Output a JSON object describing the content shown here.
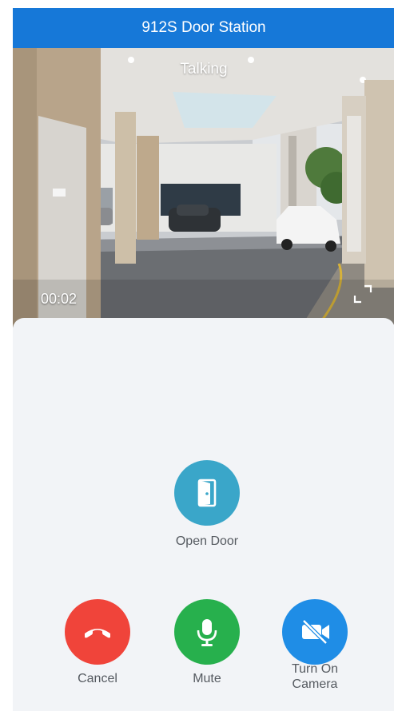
{
  "header": {
    "title": "912S Door Station"
  },
  "video": {
    "status": "Talking",
    "timer": "00:02"
  },
  "actions": {
    "open_door": {
      "label": "Open Door",
      "icon": "door-icon",
      "color": "#3aa6c9"
    },
    "cancel": {
      "label": "Cancel",
      "icon": "hang-up-icon",
      "color": "#f0443a"
    },
    "mute": {
      "label": "Mute",
      "icon": "microphone-icon",
      "color": "#27b04d"
    },
    "camera": {
      "label_line1": "Turn On",
      "label_line2": "Camera",
      "icon": "camera-off-icon",
      "color": "#1f8de6"
    }
  },
  "colors": {
    "header": "#1678d8",
    "panel": "#f2f4f7"
  }
}
